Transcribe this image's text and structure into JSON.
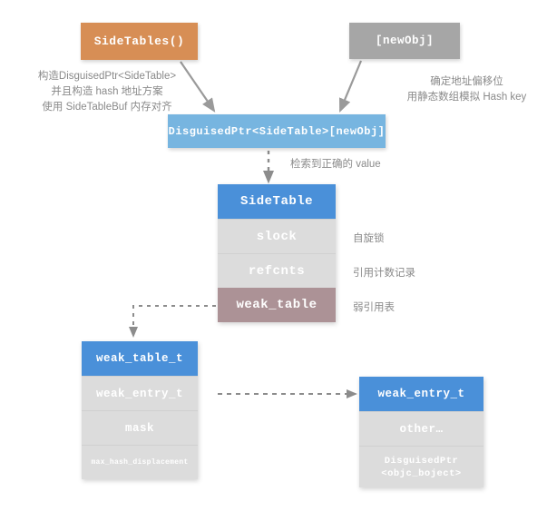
{
  "diagram": {
    "title": "SideTables weak reference structure",
    "colors": {
      "orange": "#d78e55",
      "gray": "#a6a6a6",
      "light_blue": "#77b5e0",
      "blue_header": "#4a90d9",
      "row_gray": "#dcdcdc",
      "mauve": "#ac9296",
      "note_text": "#8a8a8a",
      "arrow": "#9a9a9a",
      "background": "#ffffff"
    },
    "nodes": {
      "sidetables": {
        "label": "SideTables()"
      },
      "newobj": {
        "label": "[newObj]"
      },
      "disguised": {
        "label": "DisguisedPtr<SideTable>[newObj]"
      }
    },
    "sidetable_stack": {
      "header": "SideTable",
      "rows": [
        {
          "label": "slock",
          "note": "自旋锁"
        },
        {
          "label": "refcnts",
          "note": "引用计数记录"
        },
        {
          "label": "weak_table",
          "note": "弱引用表"
        }
      ]
    },
    "weak_table_stack": {
      "header": "weak_table_t",
      "rows": [
        {
          "label": "weak_entry_t"
        },
        {
          "label": "mask"
        },
        {
          "label": "max_hash_displacement"
        }
      ]
    },
    "weak_entry_stack": {
      "header": "weak_entry_t",
      "rows": [
        {
          "label": "other…"
        },
        {
          "label": "DisguisedPtr",
          "label2": "<objc_boject>"
        }
      ]
    },
    "notes": {
      "left": "构造DisguisedPtr<SideTable>\n并且构造 hash 地址方案\n使用 SideTableBuf 内存对齐",
      "right": "确定地址偏移位\n用静态数组模拟 Hash key",
      "value": "检索到正确的 value"
    }
  }
}
